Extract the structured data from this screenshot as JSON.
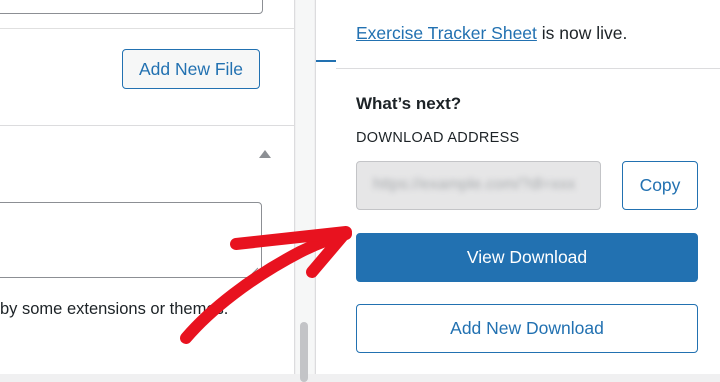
{
  "editor": {
    "add_file_label": "Add New File",
    "help_text": "by some extensions or themes."
  },
  "panel": {
    "live_link": "Exercise Tracker Sheet",
    "live_suffix": " is now live.",
    "whats_next": "What’s next?",
    "download_address_label": "DOWNLOAD ADDRESS",
    "download_address_value": "https://example.com/?dl=xxx",
    "copy_label": "Copy",
    "view_label": "View Download",
    "add_new_label": "Add New Download"
  },
  "colors": {
    "accent": "#2271b1",
    "annotation": "#e8121f"
  },
  "icons": {
    "collapse": "triangle-up-icon",
    "annotation": "red-arrow-icon"
  }
}
